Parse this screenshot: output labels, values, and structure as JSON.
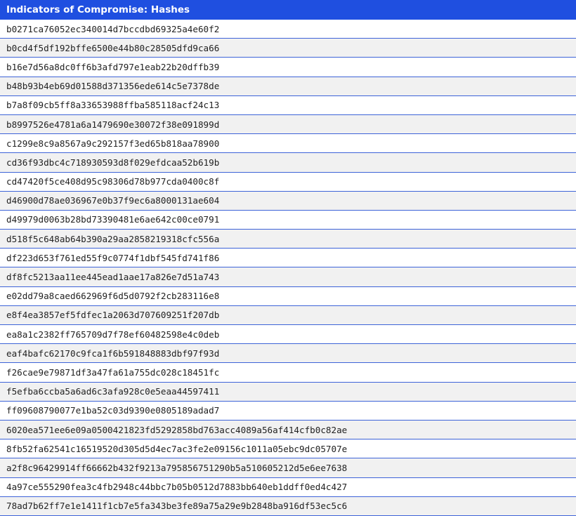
{
  "table": {
    "title": "Indicators of Compromise: Hashes",
    "hashes": [
      "b0271ca76052ec340014d7bccdbd69325a4e60f2",
      "b0cd4f5df192bffe6500e44b80c28505dfd9ca66",
      "b16e7d56a8dc0ff6b3afd797e1eab22b20dffb39",
      "b48b93b4eb69d01588d371356ede614c5e7378de",
      "b7a8f09cb5ff8a33653988ffba585118acf24c13",
      "b8997526e4781a6a1479690e30072f38e091899d",
      "c1299e8c9a8567a9c292157f3ed65b818aa78900",
      "cd36f93dbc4c718930593d8f029efdcaa52b619b",
      "cd47420f5ce408d95c98306d78b977cda0400c8f",
      "d46900d78ae036967e0b37f9ec6a8000131ae604",
      "d49979d0063b28bd73390481e6ae642c00ce0791",
      "d518f5c648ab64b390a29aa2858219318cfc556a",
      "df223d653f761ed55f9c0774f1dbf545fd741f86",
      "df8fc5213aa11ee445ead1aae17a826e7d51a743",
      "e02dd79a8caed662969f6d5d0792f2cb283116e8",
      "e8f4ea3857ef5fdfec1a2063d707609251f207db",
      "ea8a1c2382ff765709d7f78ef60482598e4c0deb",
      "eaf4bafc62170c9fca1f6b591848883dbf97f93d",
      "f26cae9e79871df3a47fa61a755dc028c18451fc",
      "f5efba6ccba5a6ad6c3afa928c0e5eaa44597411",
      "ff09608790077e1ba52c03d9390e0805189adad7",
      "6020ea571ee6e09a0500421823fd5292858bd763acc4089a56af414cfb0c82ae",
      "8fb52fa62541c16519520d305d5d4ec7ac3fe2e09156c1011a05ebc9dc05707e",
      "a2f8c96429914ff66662b432f9213a795856751290b5a510605212d5e6ee7638",
      "4a97ce555290fea3c4fb2948c44bbc7b05b0512d7883bb640eb1ddff0ed4c427",
      "78ad7b62ff7e1e1411f1cb7e5fa343be3fe89a75a29e9b2848ba916df53ec5c6"
    ]
  },
  "colors": {
    "header_bg": "#1f4fe0",
    "header_text": "#ffffff",
    "row_divider": "#3d63d8",
    "row_alt_bg": "#f1f1f1"
  }
}
